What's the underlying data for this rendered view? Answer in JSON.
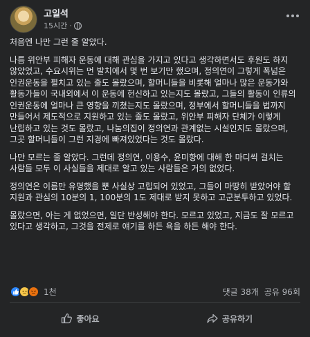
{
  "post": {
    "author": "고일석",
    "time": "15시간",
    "separator": "·",
    "visibility_icon": "globe-icon",
    "more_icon": "more-options-icon",
    "paragraphs": [
      "처음엔 나만 그런 줄 알았다.",
      "나름 위안부 피해자 운동에 대해 관심을 가지고 있다고 생각하면서도 후원도 하지 않았었고, 수요시위는 먼 발치에서 몇 번 보기만 했으며, 정의연이 그렇게 폭넓은 인권운동을 펼치고 있는 줄도 몰랐으며, 할머니들을 비롯해 얼마나 많은 운동가와 활동가들이 국내외에서 이 운동에 헌신하고 있는지도 몰랐고, 그들의 활동이 인류의 인권운동에 얼마나 큰 영향을 끼쳤는지도 몰랐으며, 정부에서 할머니들을 법까지 만들어서 제도적으로 지원하고 있는 줄도 몰랐고, 위안부 피해자 단체가 이렇게 난립하고 있는 것도 몰랐고, 나눔의집이 정의연과 관계없는 시설인지도 몰랐으며, 그곳 할머니들이 그런 지경에 빠져있었다는 것도 몰랐다.",
      "나만 모르는 줄 알았다. 그런데 정의연, 이용수, 윤미향에 대해 한 마디씩 걸치는 사람들 모두 이 사실들을 제대로 알고 있는 사람들은 거의 없었다.",
      "정의연은 이름만 유명했을 뿐 사실상 고립되어 있었고, 그들이 마땅히 받았어야 할 지원과 관심의 10분의 1, 100분의 1도 제대로 받지 못하고 고군분투하고 있었다.",
      "몰랐으면, 아는 게 없었으면, 일단 반성해야 한다. 모르고 있었고, 지금도 잘 모르고 있다고 생각하고, 그것을 전제로 얘기를 하든 욕을 하든 해야 한다."
    ]
  },
  "reactions": {
    "icons": [
      "like-reaction-icon",
      "sad-reaction-icon",
      "angry-reaction-icon"
    ],
    "count": "1천"
  },
  "stats": {
    "comments": "댓글 38개",
    "shares": "공유 96회"
  },
  "actions": {
    "like_label": "좋아요",
    "share_label": "공유하기"
  },
  "colors": {
    "background": "#242526",
    "text": "#e4e6eb",
    "secondary_text": "#b0b3b8",
    "like_blue": "#2d88ff"
  }
}
